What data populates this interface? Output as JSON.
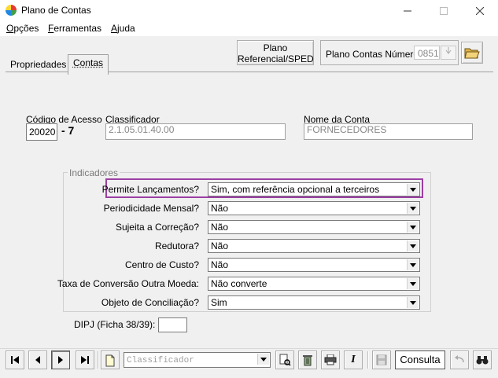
{
  "window": {
    "title": "Plano de Contas",
    "minimize": "—",
    "maximize": "☐",
    "close": "✕"
  },
  "menu": [
    {
      "label": "Opções",
      "underline": "O"
    },
    {
      "label": "Ferramentas",
      "underline": "F"
    },
    {
      "label": "Ajuda",
      "underline": "A"
    }
  ],
  "tabs": {
    "propriedades": "Propriedades",
    "contas": "Contas",
    "active": "Contas"
  },
  "header": {
    "plano_ref_line1": "Plano",
    "plano_ref_line2": "Referencial/SPED",
    "numero_label": "Plano Contas Número",
    "numero_value": "0851"
  },
  "fields": {
    "codigo_label": "Código de Acesso",
    "codigo_value": "20020",
    "codigo_suffix": "- 7",
    "classificador_label": "Classificador",
    "classificador_value": "2.1.05.01.40.00",
    "nome_label": "Nome da Conta",
    "nome_value": "FORNECEDORES"
  },
  "indicadores": {
    "title": "Indicadores",
    "rows": [
      {
        "label": "Permite Lançamentos?",
        "value": "Sim, com referência opcional a terceiros"
      },
      {
        "label": "Periodicidade Mensal?",
        "value": "Não"
      },
      {
        "label": "Sujeita a Correção?",
        "value": "Não"
      },
      {
        "label": "Redutora?",
        "value": "Não"
      },
      {
        "label": "Centro de Custo?",
        "value": "Não"
      },
      {
        "label": "Taxa de Conversão Outra Moeda:",
        "value": "Não converte"
      },
      {
        "label": "Objeto de Conciliação?",
        "value": "Sim"
      }
    ]
  },
  "dipj": {
    "label": "DIPJ (Ficha 38/39):",
    "value": ""
  },
  "toolbar": {
    "classificador_placeholder": "Classificador",
    "consulta_label": "Consulta"
  },
  "colors": {
    "highlight": "#9c3fa3",
    "panel": "#f0f0f0"
  }
}
